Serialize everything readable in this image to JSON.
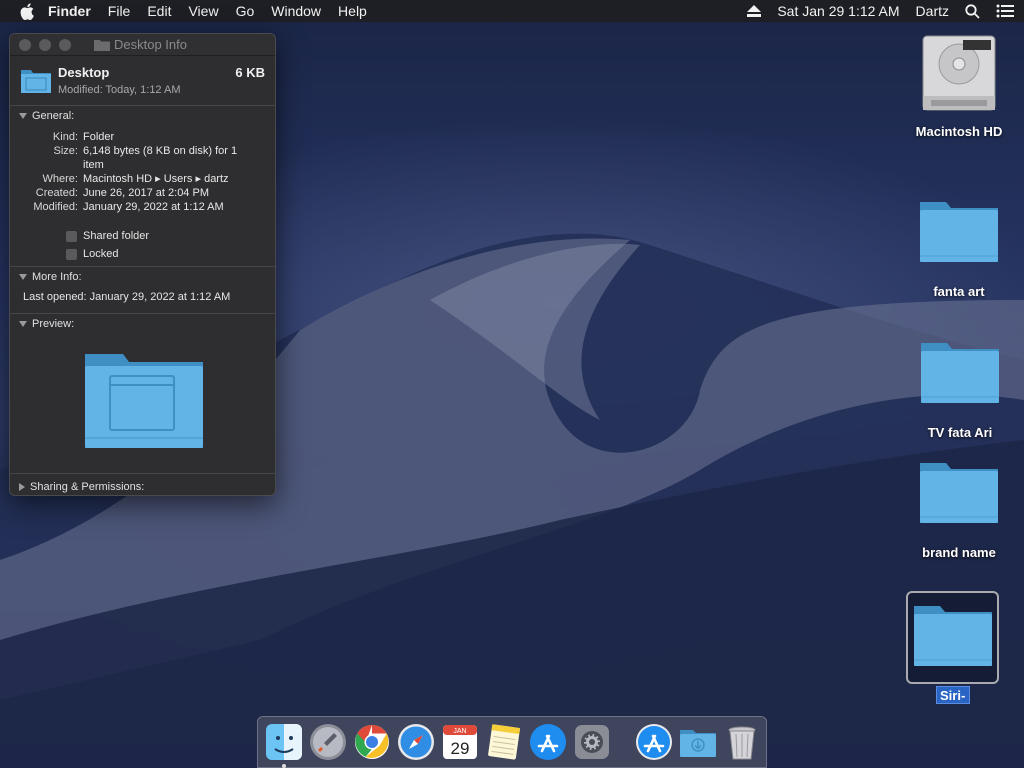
{
  "menubar": {
    "app": "Finder",
    "items": [
      "File",
      "Edit",
      "View",
      "Go",
      "Window",
      "Help"
    ],
    "datetime": "Sat Jan 29  1:12 AM",
    "user": "Dartz"
  },
  "info_window": {
    "title": "Desktop Info",
    "name": "Desktop",
    "size_badge": "6 KB",
    "modified_short": "Modified: Today, 1:12 AM",
    "general": {
      "heading": "General:",
      "kind_label": "Kind:",
      "kind": "Folder",
      "size_label": "Size:",
      "size": "6,148 bytes (8 KB on disk) for 1 item",
      "where_label": "Where:",
      "where": "Macintosh HD ▸ Users ▸ dartz",
      "created_label": "Created:",
      "created": "June 26, 2017 at 2:04 PM",
      "modified_label": "Modified:",
      "modified": "January 29, 2022 at 1:12 AM",
      "shared_folder": "Shared folder",
      "locked": "Locked"
    },
    "more_info": {
      "heading": "More Info:",
      "last_opened": "Last opened: January 29, 2022 at 1:12 AM"
    },
    "preview": {
      "heading": "Preview:"
    },
    "sharing": {
      "heading": "Sharing & Permissions:"
    }
  },
  "desktop_icons": [
    {
      "label": "Macintosh HD",
      "type": "drive"
    },
    {
      "label": "fanta art",
      "type": "folder"
    },
    {
      "label": "TV fata Ari",
      "type": "folder"
    },
    {
      "label": "brand name",
      "type": "folder"
    },
    {
      "label": "Siri-",
      "type": "folder",
      "renaming": true
    }
  ],
  "calendar": {
    "month": "JAN",
    "day": "29"
  },
  "colors": {
    "folder": "#62b4e6",
    "folder_dark": "#3f8fc4",
    "rename_highlight": "#2a64c5"
  }
}
